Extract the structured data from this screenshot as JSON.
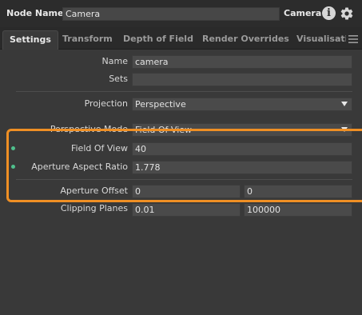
{
  "header": {
    "node_name_label": "Node Name",
    "node_name_value": "Camera",
    "node_type": "Camera",
    "info_glyph": "i"
  },
  "tabs": [
    {
      "label": "Settings",
      "active": true
    },
    {
      "label": "Transform"
    },
    {
      "label": "Depth of Field"
    },
    {
      "label": "Render Overrides"
    },
    {
      "label": "Visualisatic"
    }
  ],
  "fields": {
    "name": {
      "label": "Name",
      "value": "camera"
    },
    "sets": {
      "label": "Sets",
      "value": ""
    },
    "projection": {
      "label": "Projection",
      "value": "Perspective"
    },
    "perspective_mode": {
      "label": "Perspective Mode",
      "value": "Field Of View"
    },
    "field_of_view": {
      "label": "Field Of View",
      "value": "40"
    },
    "aperture_aspect_ratio": {
      "label": "Aperture Aspect Ratio",
      "value": "1.778"
    },
    "aperture_offset": {
      "label": "Aperture Offset",
      "value_x": "0",
      "value_y": "0"
    },
    "clipping_planes": {
      "label": "Clipping Planes",
      "value_near": "0.01",
      "value_far": "100000"
    }
  },
  "colors": {
    "highlight": "#ef8f24",
    "animated_dot": "#4fc08d"
  }
}
